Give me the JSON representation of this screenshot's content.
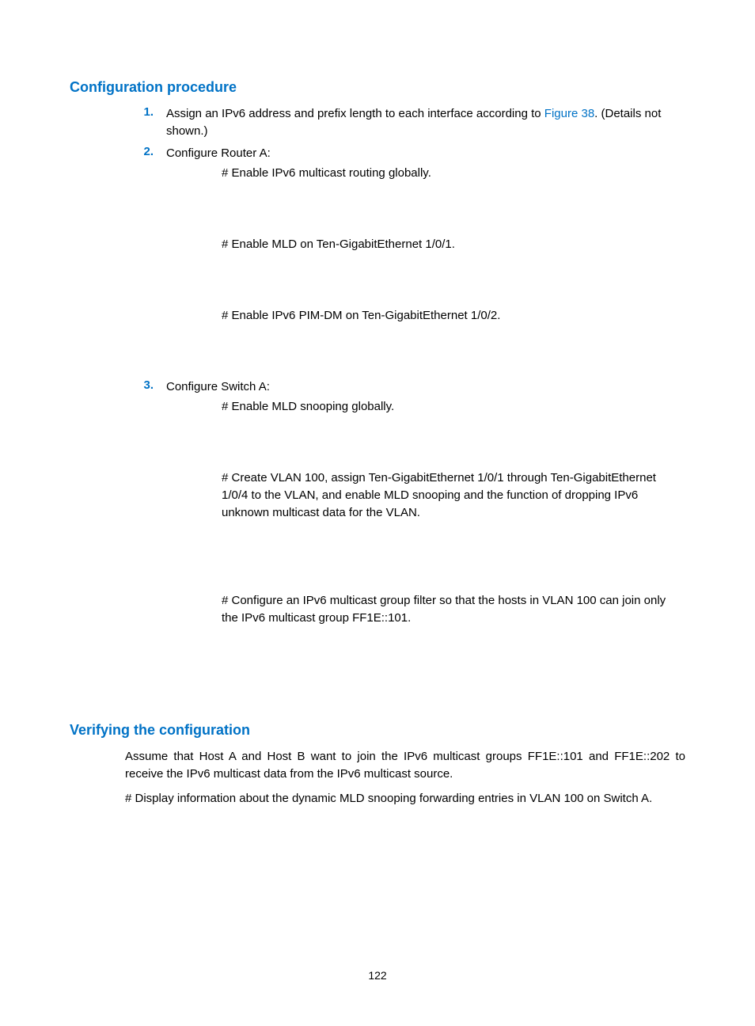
{
  "section1": {
    "heading": "Configuration procedure",
    "items": [
      {
        "num": "1.",
        "text_before_link": "Assign an IPv6 address and prefix length to each interface according to ",
        "link": "Figure 38",
        "text_after_link": ". (Details not shown.)"
      },
      {
        "num": "2.",
        "text": "Configure Router A:"
      }
    ],
    "step2_lines": [
      "# Enable IPv6 multicast routing globally.",
      "# Enable MLD on Ten-GigabitEthernet 1/0/1.",
      "# Enable IPv6 PIM-DM on Ten-GigabitEthernet 1/0/2."
    ],
    "item3": {
      "num": "3.",
      "text": "Configure Switch A:"
    },
    "step3_lines": [
      "# Enable MLD snooping globally.",
      "# Create VLAN 100, assign Ten-GigabitEthernet 1/0/1 through Ten-GigabitEthernet 1/0/4 to the VLAN, and enable MLD snooping and the function of dropping IPv6 unknown multicast data for the VLAN.",
      "# Configure an IPv6 multicast group filter so that the hosts in VLAN 100 can join only the IPv6 multicast group FF1E::101."
    ]
  },
  "section2": {
    "heading": "Verifying the configuration",
    "paras": [
      "Assume that Host A and Host B want to join the IPv6 multicast groups FF1E::101 and FF1E::202 to receive the IPv6 multicast data from the IPv6 multicast source.",
      "# Display information about the dynamic MLD snooping forwarding entries in VLAN 100 on Switch A."
    ]
  },
  "page_number": "122"
}
